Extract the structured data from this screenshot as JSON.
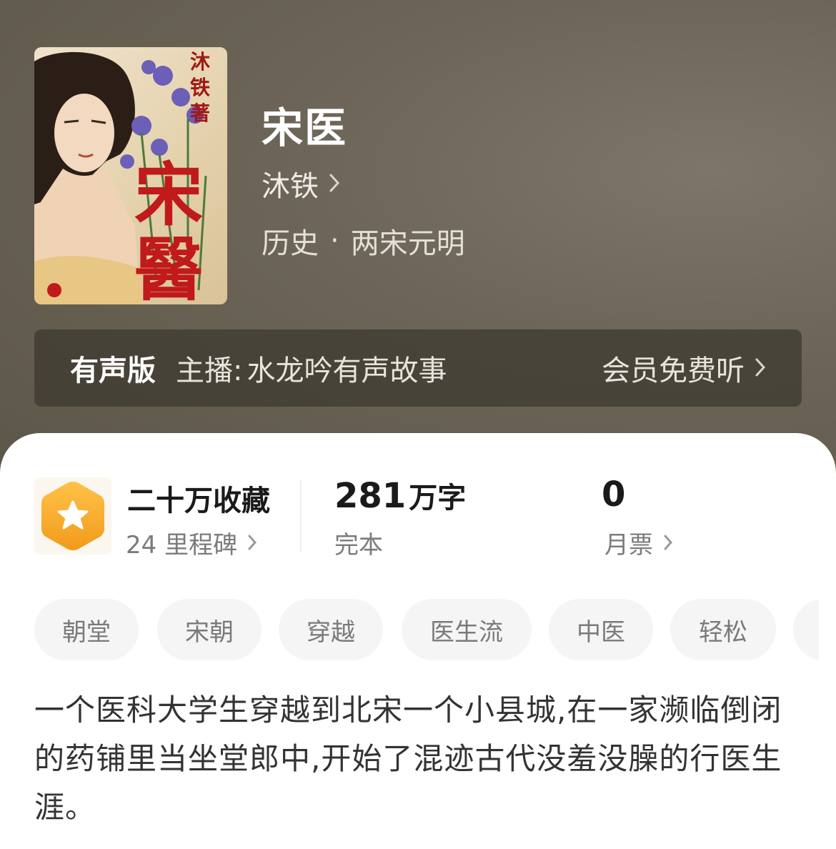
{
  "book": {
    "title": "宋医",
    "author": "沐铁",
    "category": "历史",
    "separator": "·",
    "subcategory": "两宋元明",
    "cover_text": "沐铁著 宋醫"
  },
  "audio": {
    "label": "有声版",
    "host_prefix": "主播",
    "host_colon": ":",
    "host_name": "水龙吟有声故事",
    "cta": "会员免费听"
  },
  "stats": {
    "favorites": "二十万收藏",
    "milestones": "24 里程碑",
    "word_count_num": "281",
    "word_count_unit": "万字",
    "status": "完本",
    "monthly_tickets": "0",
    "monthly_tickets_label": "月票"
  },
  "tags": [
    "朝堂",
    "宋朝",
    "穿越",
    "医生流",
    "中医",
    "轻松"
  ],
  "synopsis": "一个医科大学生穿越到北宋一个小县城,在一家濒临倒闭的药铺里当坐堂郎中,开始了混迹古代没羞没臊的行医生涯。",
  "colors": {
    "hero_bg": "#6d6658",
    "badge_orange": "#f6a623",
    "text_dark": "#1a1a1a",
    "text_muted": "#7b7b7b",
    "tag_bg": "#f5f5f5"
  }
}
